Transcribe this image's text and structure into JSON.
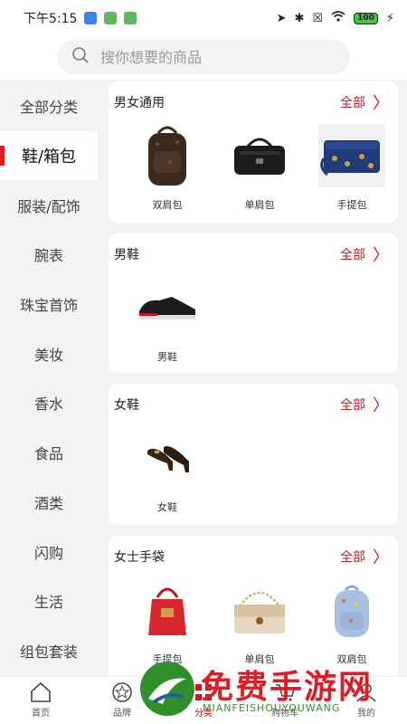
{
  "status": {
    "time": "下午5:15",
    "battery": "100"
  },
  "search": {
    "placeholder": "搜你想要的商品"
  },
  "sidebar": {
    "items": [
      {
        "label": "全部分类"
      },
      {
        "label": "鞋/箱包"
      },
      {
        "label": "服装/配饰"
      },
      {
        "label": "腕表"
      },
      {
        "label": "珠宝首饰"
      },
      {
        "label": "美妆"
      },
      {
        "label": "香水"
      },
      {
        "label": "食品"
      },
      {
        "label": "酒类"
      },
      {
        "label": "闪购"
      },
      {
        "label": "生活"
      },
      {
        "label": "组包套装"
      }
    ],
    "active_index": 1
  },
  "sections": [
    {
      "title": "男女通用",
      "all": "全部",
      "items": [
        {
          "name": "双肩包"
        },
        {
          "name": "单肩包"
        },
        {
          "name": "手提包"
        }
      ]
    },
    {
      "title": "男鞋",
      "all": "全部",
      "items": [
        {
          "name": "男鞋"
        }
      ]
    },
    {
      "title": "女鞋",
      "all": "全部",
      "items": [
        {
          "name": "女鞋"
        }
      ]
    },
    {
      "title": "女士手袋",
      "all": "全部",
      "items": [
        {
          "name": "手提包"
        },
        {
          "name": "单肩包"
        },
        {
          "name": "双肩包"
        }
      ]
    }
  ],
  "tabbar": {
    "items": [
      {
        "label": "首页",
        "icon": "home-icon"
      },
      {
        "label": "品牌",
        "icon": "star-icon"
      },
      {
        "label": "分类",
        "icon": "category-icon"
      },
      {
        "label": "购物车",
        "icon": "cart-icon"
      },
      {
        "label": "我的",
        "icon": "user-icon"
      }
    ]
  },
  "watermark": {
    "title": "免费手游网",
    "subtitle": "MIANFEISHOUYOUWANG"
  },
  "colors": {
    "accent": "#c8161d",
    "active_bar": "#e31b23"
  }
}
